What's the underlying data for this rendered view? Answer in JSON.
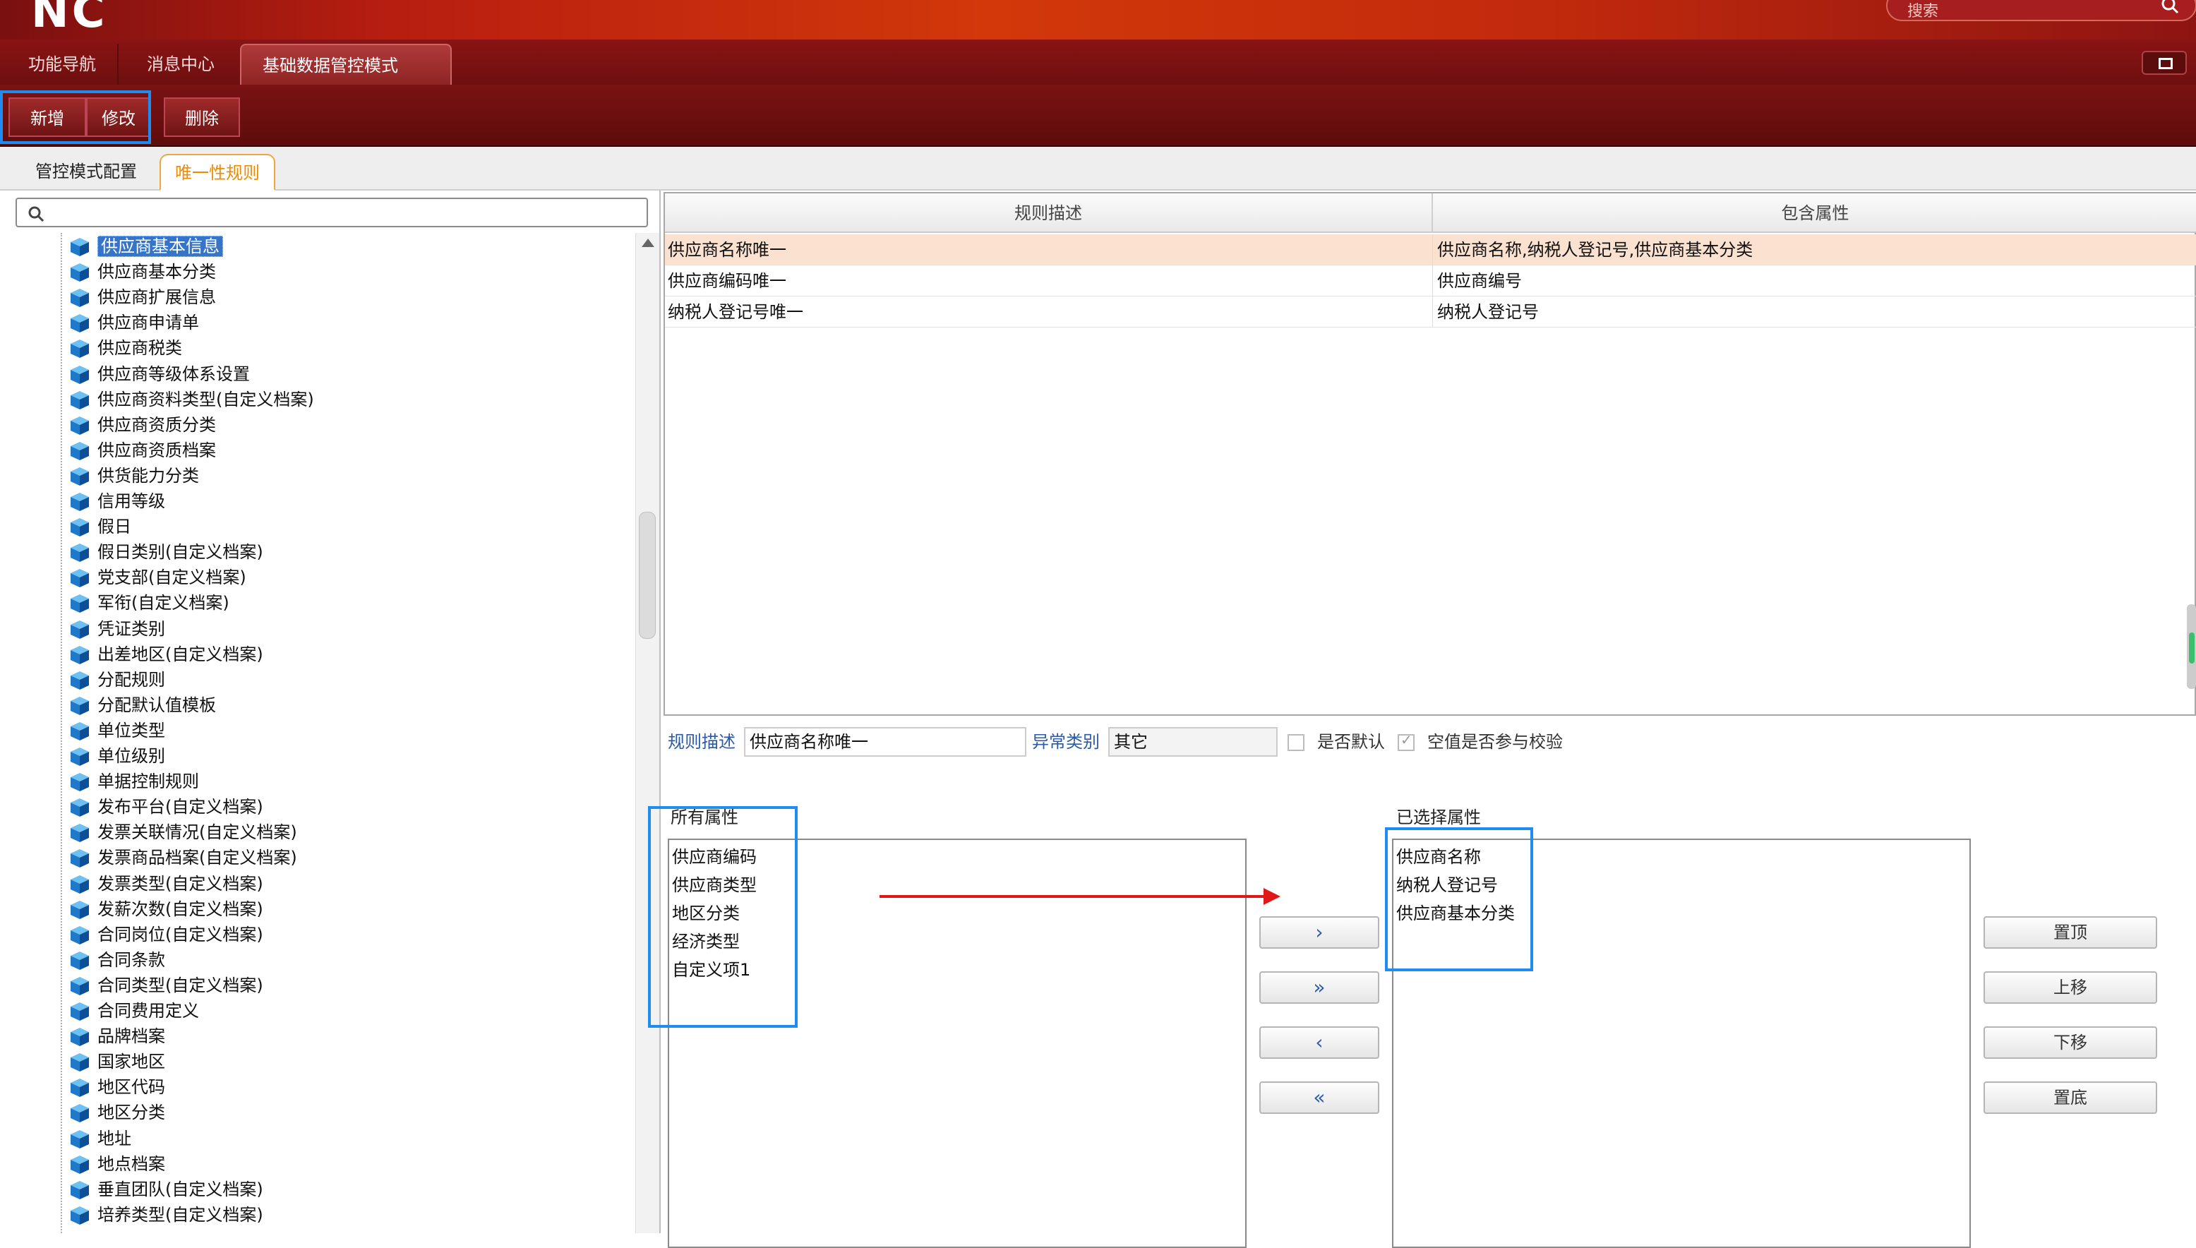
{
  "header": {
    "logo": "NC",
    "search_placeholder": "搜索"
  },
  "nav": {
    "tabs": [
      {
        "label": "功能导航"
      },
      {
        "label": "消息中心"
      },
      {
        "label": "基础数据管控模式"
      }
    ]
  },
  "toolbar": {
    "add_label": "新增",
    "edit_label": "修改",
    "delete_label": "删除"
  },
  "subtabs": [
    {
      "label": "管控模式配置"
    },
    {
      "label": "唯一性规则"
    }
  ],
  "tree": {
    "items": [
      "供应商基本信息",
      "供应商基本分类",
      "供应商扩展信息",
      "供应商申请单",
      "供应商税类",
      "供应商等级体系设置",
      "供应商资料类型(自定义档案)",
      "供应商资质分类",
      "供应商资质档案",
      "供货能力分类",
      "信用等级",
      "假日",
      "假日类别(自定义档案)",
      "党支部(自定义档案)",
      "军衔(自定义档案)",
      "凭证类别",
      "出差地区(自定义档案)",
      "分配规则",
      "分配默认值模板",
      "单位类型",
      "单位级别",
      "单据控制规则",
      "发布平台(自定义档案)",
      "发票关联情况(自定义档案)",
      "发票商品档案(自定义档案)",
      "发票类型(自定义档案)",
      "发薪次数(自定义档案)",
      "合同岗位(自定义档案)",
      "合同条款",
      "合同类型(自定义档案)",
      "合同费用定义",
      "品牌档案",
      "国家地区",
      "地区代码",
      "地区分类",
      "地址",
      "地点档案",
      "垂直团队(自定义档案)",
      "培养类型(自定义档案)"
    ],
    "selected_index": 0
  },
  "grid": {
    "columns": [
      "规则描述",
      "包含属性"
    ],
    "rows": [
      {
        "desc": "供应商名称唯一",
        "attrs": "供应商名称,纳税人登记号,供应商基本分类"
      },
      {
        "desc": "供应商编码唯一",
        "attrs": "供应商编号"
      },
      {
        "desc": "纳税人登记号唯一",
        "attrs": "纳税人登记号"
      }
    ],
    "selected_row": 0
  },
  "form": {
    "rule_desc_label": "规则描述",
    "rule_desc_value": "供应商名称唯一",
    "exception_label": "异常类别",
    "exception_value": "其它",
    "is_default_label": "是否默认",
    "is_default_checked": false,
    "null_check_label": "空值是否参与校验",
    "null_check_checked": true
  },
  "transfer": {
    "all_title": "所有属性",
    "all_items": [
      "供应商编码",
      "供应商类型",
      "地区分类",
      "经济类型",
      "自定义项1"
    ],
    "selected_title": "已选择属性",
    "selected_items": [
      "供应商名称",
      "纳税人登记号",
      "供应商基本分类"
    ],
    "move_buttons": [
      "›",
      "»",
      "‹",
      "«"
    ],
    "order_buttons": [
      "置顶",
      "上移",
      "下移",
      "置底"
    ]
  },
  "colors": {
    "highlight_box": "#1e8cf0",
    "annotation_arrow": "#e01818",
    "selected_row": "#fbe1cf",
    "tab_active_text": "#f08a00"
  }
}
